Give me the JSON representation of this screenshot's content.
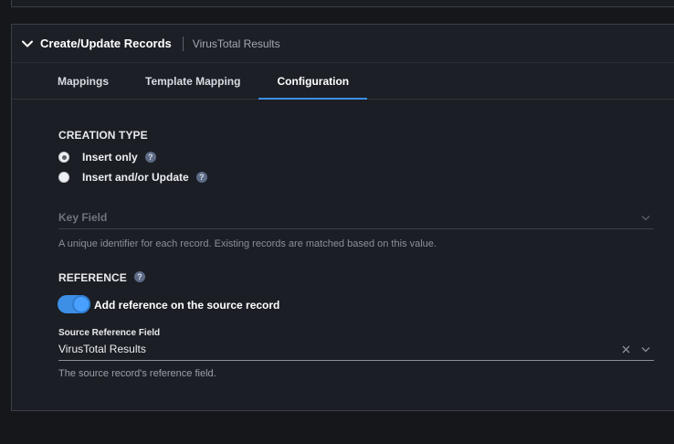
{
  "panel": {
    "title": "Create/Update Records",
    "subtitle": "VirusTotal Results"
  },
  "tabs": [
    {
      "label": "Mappings",
      "active": false
    },
    {
      "label": "Template Mapping",
      "active": false
    },
    {
      "label": "Configuration",
      "active": true
    }
  ],
  "creation_type": {
    "heading": "CREATION TYPE",
    "options": [
      {
        "label": "Insert only",
        "selected": true
      },
      {
        "label": "Insert and/or Update",
        "selected": false
      }
    ]
  },
  "key_field": {
    "placeholder": "Key Field",
    "hint": "A unique identifier for each record. Existing records are matched based on this value."
  },
  "reference": {
    "heading": "REFERENCE",
    "toggle_label": "Add reference on the source record",
    "toggle_on": true,
    "source_field_label": "Source Reference Field",
    "source_field_value": "VirusTotal Results",
    "source_field_hint": "The source record's reference field."
  },
  "colors": {
    "accent": "#3d8fe6",
    "panel_bg": "#1c1f25",
    "page_bg": "#15171b"
  },
  "icons": {
    "collapse": "chevron-down-icon",
    "help": "question-icon",
    "clear": "close-icon",
    "dropdown": "chevron-down-icon"
  }
}
